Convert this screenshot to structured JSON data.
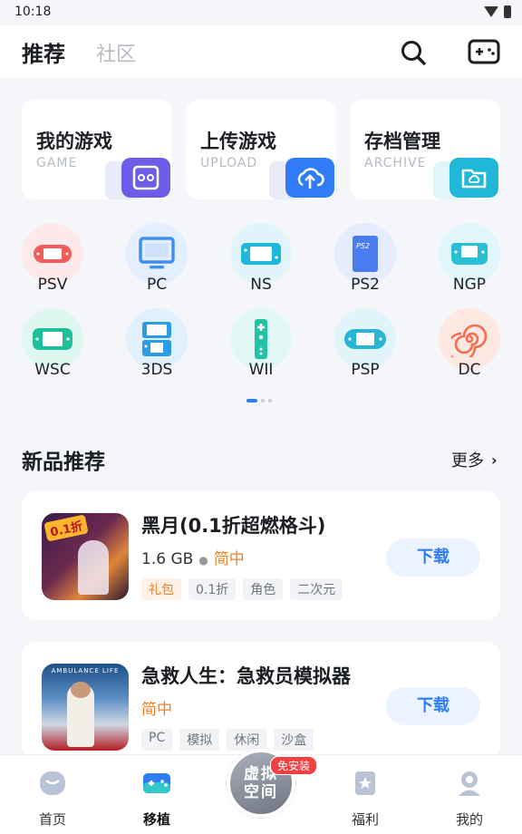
{
  "status_bar": {
    "time": "10:18"
  },
  "header": {
    "tab_active": "推荐",
    "tab_inactive": "社区",
    "search_icon": "search-icon",
    "gamepad_icon": "gamepad-icon"
  },
  "feature_cards": [
    {
      "title": "我的游戏",
      "subtitle": "GAME",
      "icon": "gamepad-icon",
      "color": "#6c5ce7"
    },
    {
      "title": "上传游戏",
      "subtitle": "UPLOAD",
      "icon": "cloud-upload-icon",
      "color": "#2f7cf6"
    },
    {
      "title": "存档管理",
      "subtitle": "ARCHIVE",
      "icon": "folder-icon",
      "color": "#1fb8d8"
    }
  ],
  "platforms": [
    {
      "label": "PSV",
      "icon": "psv-console-icon",
      "color": "#f05b5b",
      "bg": "#fde9e9"
    },
    {
      "label": "PC",
      "icon": "pc-monitor-icon",
      "color": "#3e8ef7",
      "bg": "#e3efff"
    },
    {
      "label": "NS",
      "icon": "switch-console-icon",
      "color": "#1fb8d8",
      "bg": "#dff5fb"
    },
    {
      "label": "PS2",
      "icon": "ps2-console-icon",
      "color": "#4a7cf0",
      "bg": "#e5ecfd"
    },
    {
      "label": "NGP",
      "icon": "ngp-console-icon",
      "color": "#2bbfd6",
      "bg": "#e0f6fa"
    },
    {
      "label": "WSC",
      "icon": "wsc-console-icon",
      "color": "#1fbf9c",
      "bg": "#dff7f1"
    },
    {
      "label": "3DS",
      "icon": "3ds-console-icon",
      "color": "#2a9ce8",
      "bg": "#e0f0fc"
    },
    {
      "label": "WII",
      "icon": "wii-remote-icon",
      "color": "#23c2a6",
      "bg": "#e0f7f3"
    },
    {
      "label": "PSP",
      "icon": "psp-console-icon",
      "color": "#29b6d6",
      "bg": "#e0f4fa"
    },
    {
      "label": "DC",
      "icon": "dc-spiral-icon",
      "color": "#f36c4f",
      "bg": "#fde8e2"
    }
  ],
  "pager": {
    "pages": 3,
    "active": 0
  },
  "section": {
    "title": "新品推荐",
    "more": "更多"
  },
  "games": [
    {
      "name": "黑月(0.1折超燃格斗)",
      "size": "1.6 GB",
      "language": "简中",
      "tags": [
        "礼包",
        "0.1折",
        "角色",
        "二次元"
      ],
      "hot_tag_index": 0,
      "button": "下载",
      "thumb_badge": "0.1折"
    },
    {
      "name": "急救人生：急救员模拟器",
      "size": "",
      "language": "简中",
      "tags": [
        "PC",
        "模拟",
        "休闲",
        "沙盒"
      ],
      "hot_tag_index": -1,
      "button": "下载",
      "thumb_badge": "AMBULANCE LIFE"
    }
  ],
  "tab_bar": {
    "items": [
      {
        "label": "首页",
        "icon": "home-icon"
      },
      {
        "label": "移植",
        "icon": "port-gamepad-icon"
      },
      {
        "label": "福利",
        "icon": "gift-icon"
      },
      {
        "label": "我的",
        "icon": "profile-icon"
      }
    ],
    "center_label": "虚拟空间",
    "center_badge": "免安装",
    "active_index": 1
  }
}
